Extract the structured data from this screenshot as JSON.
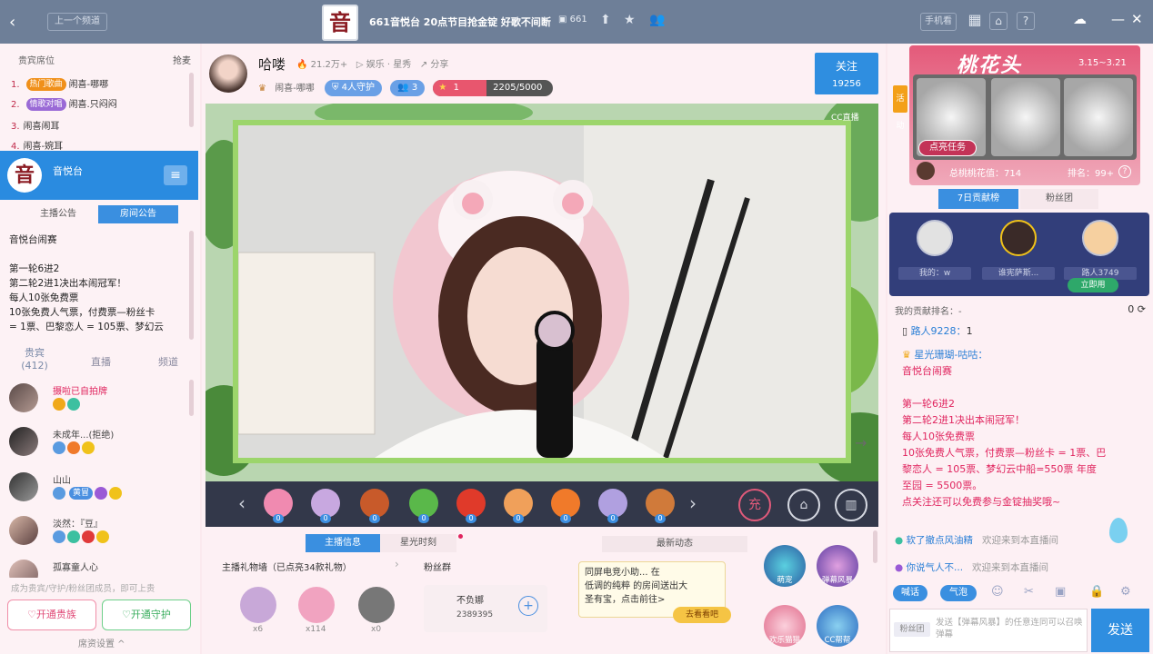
{
  "topbar": {
    "back_icon": "chevron-left-icon",
    "prev_button": "上一个频道",
    "logo_char": "音",
    "title": "661音悦台 20点节目抢金锭 好歌不间断",
    "online_count": "661",
    "phone_button": "手机看"
  },
  "left": {
    "rank_header": "贵宾席位",
    "rank_header_right": "抢麦",
    "ranks": [
      {
        "num": "1.",
        "tag": "热门歌曲",
        "tag_color": "#f0901a",
        "name": "闹喜-哪哪"
      },
      {
        "num": "2.",
        "tag": "情歌对唱",
        "tag_color": "#9a6ad6",
        "name": "闹喜.只闷闷"
      },
      {
        "num": "3.",
        "tag": "",
        "tag_color": "",
        "name": "闹喜闹耳"
      },
      {
        "num": "4.",
        "tag": "",
        "tag_color": "",
        "name": "闹喜-婉耳"
      }
    ],
    "app_name": "音悦台",
    "app_logo": "音",
    "tabs": [
      "主播公告",
      "房间公告"
    ],
    "announcement": [
      "音悦台闹赛",
      "",
      "第一轮6进2",
      "第二轮2进1决出本闹冠军！",
      "每人10张免费票",
      "10张免费人气票，付费票—粉丝卡",
      "= 1票、巴黎恋人 = 105票、梦幻云"
    ],
    "view_tabs": [
      {
        "label": "贵宾\n(412)"
      },
      {
        "label": "直播"
      },
      {
        "label": "频道"
      }
    ],
    "users": [
      {
        "name": "摄啦已自拍牌",
        "name_color": "#e0245e"
      },
      {
        "name": "未成年...(拒绝)",
        "name_color": "#444"
      },
      {
        "name": "山山",
        "name_color": "#444",
        "badge": "黄冒"
      },
      {
        "name": "淡然：『豆』",
        "name_color": "#444"
      },
      {
        "name": "孤寡童人心",
        "name_color": "#444"
      }
    ],
    "bottom_note": "成为贵宾/守护/粉丝团成员，即可上贵",
    "open_vip": "♡开通贵族",
    "open_guard": "♡开通守护",
    "settings": "席资设置 ^"
  },
  "center": {
    "anchor_name": "哈喽",
    "anchor_heat": "21.2万+",
    "anchor_category": "娱乐 · 星秀",
    "share": "分享",
    "anchor_tag": "闹喜-哪哪",
    "guard_pill": "4人守护",
    "fans_pill": "3",
    "level_pill": "1",
    "level_progress": "2205/5000",
    "level_fraction": 0.441,
    "follow_label": "关注",
    "follow_count": "19256",
    "video_watermark": "CC直播",
    "gift_count": "0",
    "bottom_tabs": [
      "主播信息",
      "星光时刻"
    ],
    "gift_wall_title": "主播礼物墙（已点亮34款礼物）",
    "gift_wall": [
      {
        "count": "x6",
        "color": "#c8a8d8"
      },
      {
        "count": "x114",
        "color": "#f1a3c0"
      },
      {
        "count": "x0",
        "color": "#777"
      }
    ],
    "fan_title": "粉丝群",
    "fan_name": "不负娜",
    "fan_id": "2389395",
    "news_title": "最新动态",
    "news_text": "同屏电竞小助... 在\n低调的纯粹 的房间送出大\n圣有宝，点击前往>",
    "news_tag": "去看看吧",
    "fun_labels": [
      "萌宠",
      "弹幕风暴",
      "欢乐猫猫",
      "CC帮帮"
    ]
  },
  "right": {
    "event_title": "桃花头",
    "event_date": "3.15~3.21",
    "event_task": "点亮任务",
    "event_total": "总桃桃花值：714",
    "event_rank": "排名：99+",
    "side_tag": "活动",
    "tabs": [
      "7日贡献榜",
      "粉丝团"
    ],
    "rank_users": [
      "我的：w",
      "谁宪萨斯...",
      "路人3749"
    ],
    "rank_up_button": "立即用",
    "my_contrib_label": "我的贡献排名：-",
    "my_contrib_value": "0",
    "chat": [
      {
        "prefix": "路人9228：",
        "text": "1",
        "color": "#333"
      },
      {
        "prefix": "星光珊瑚-咕咕：",
        "text": "",
        "color": "#e0245e"
      },
      {
        "prefix": "",
        "text": "音悦台闹赛",
        "color": "#e0245e"
      },
      {
        "prefix": "",
        "text": "",
        "color": "#e0245e"
      },
      {
        "prefix": "",
        "text": "第一轮6进2",
        "color": "#e0245e"
      },
      {
        "prefix": "",
        "text": "第二轮2进1决出本闹冠军！",
        "color": "#e0245e"
      },
      {
        "prefix": "",
        "text": "每人10张免费票",
        "color": "#e0245e"
      },
      {
        "prefix": "",
        "text": "10张免费人气票，付费票—粉丝卡 = 1票、巴",
        "color": "#e0245e"
      },
      {
        "prefix": "",
        "text": "黎恋人 = 105票、梦幻云中船=550票  年度",
        "color": "#e0245e"
      },
      {
        "prefix": "",
        "text": "至园 = 5500票。",
        "color": "#e0245e"
      },
      {
        "prefix": "",
        "text": "点关注还可以免费参与金锭抽奖哦~",
        "color": "#e0245e"
      }
    ],
    "sys1_name": "软了撤点风油精",
    "sys1_text": "欢迎来到本直播间",
    "sys2_name": "你说气人不...",
    "sys2_text": "欢迎来到本直播间",
    "tool_btn1": "喊话",
    "tool_btn2": "气泡",
    "input_level": "粉丝团",
    "input_placeholder": "发送【弹幕风暴】的任意连同可以召唤弹幕",
    "send": "发送"
  }
}
